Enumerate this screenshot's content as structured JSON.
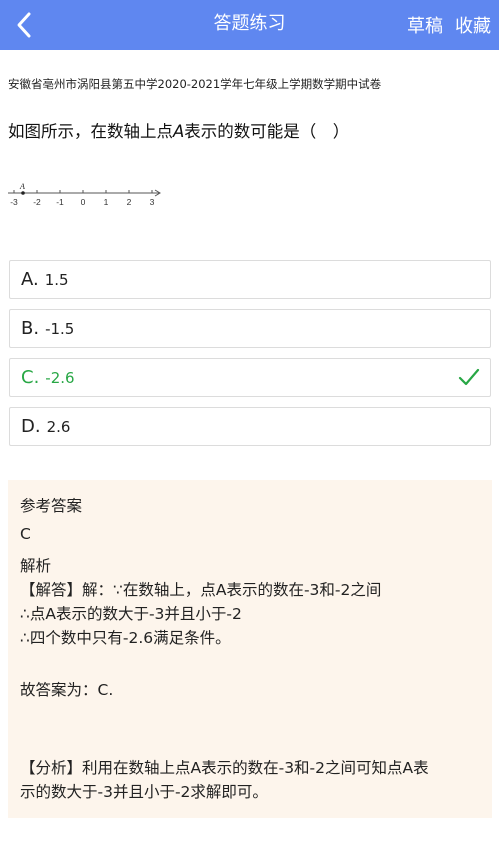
{
  "header": {
    "title": "答题练习",
    "draft": "草稿",
    "favorite": "收藏",
    "back_icon": "chevron-left-icon"
  },
  "colors": {
    "header_bg": "#5f87f0",
    "correct": "#28a745",
    "answer_bg": "#fdf5ec"
  },
  "question": {
    "source": "安徽省亳州市涡阳县第五中学2020-2021学年七年级上学期数学期中试卷",
    "stem_before": "如图所示，在数轴上点",
    "stem_var": "A",
    "stem_after": "表示的数可能是（　）",
    "figure": {
      "point_label": "A",
      "ticks": [
        "-3",
        "-2",
        "-1",
        "0",
        "1",
        "2",
        "3"
      ]
    }
  },
  "options": [
    {
      "letter": "A.",
      "value": "1.5",
      "correct": false
    },
    {
      "letter": "B.",
      "value": "-1.5",
      "correct": false
    },
    {
      "letter": "C.",
      "value": "-2.6",
      "correct": true
    },
    {
      "letter": "D.",
      "value": "2.6",
      "correct": false
    }
  ],
  "answer": {
    "ref_title": "参考答案",
    "ref_value": "C",
    "analysis_title": "解析",
    "lines": [
      "【解答】解：∵在数轴上，点A表示的数在-3和-2之间",
      "∴点A表示的数大于-3并且小于-2",
      "∴四个数中只有-2.6满足条件。",
      "故答案为：C.",
      "【分析】利用在数轴上点A表示的数在-3和-2之间可知点A表",
      "示的数大于-3并且小于-2求解即可。"
    ]
  }
}
